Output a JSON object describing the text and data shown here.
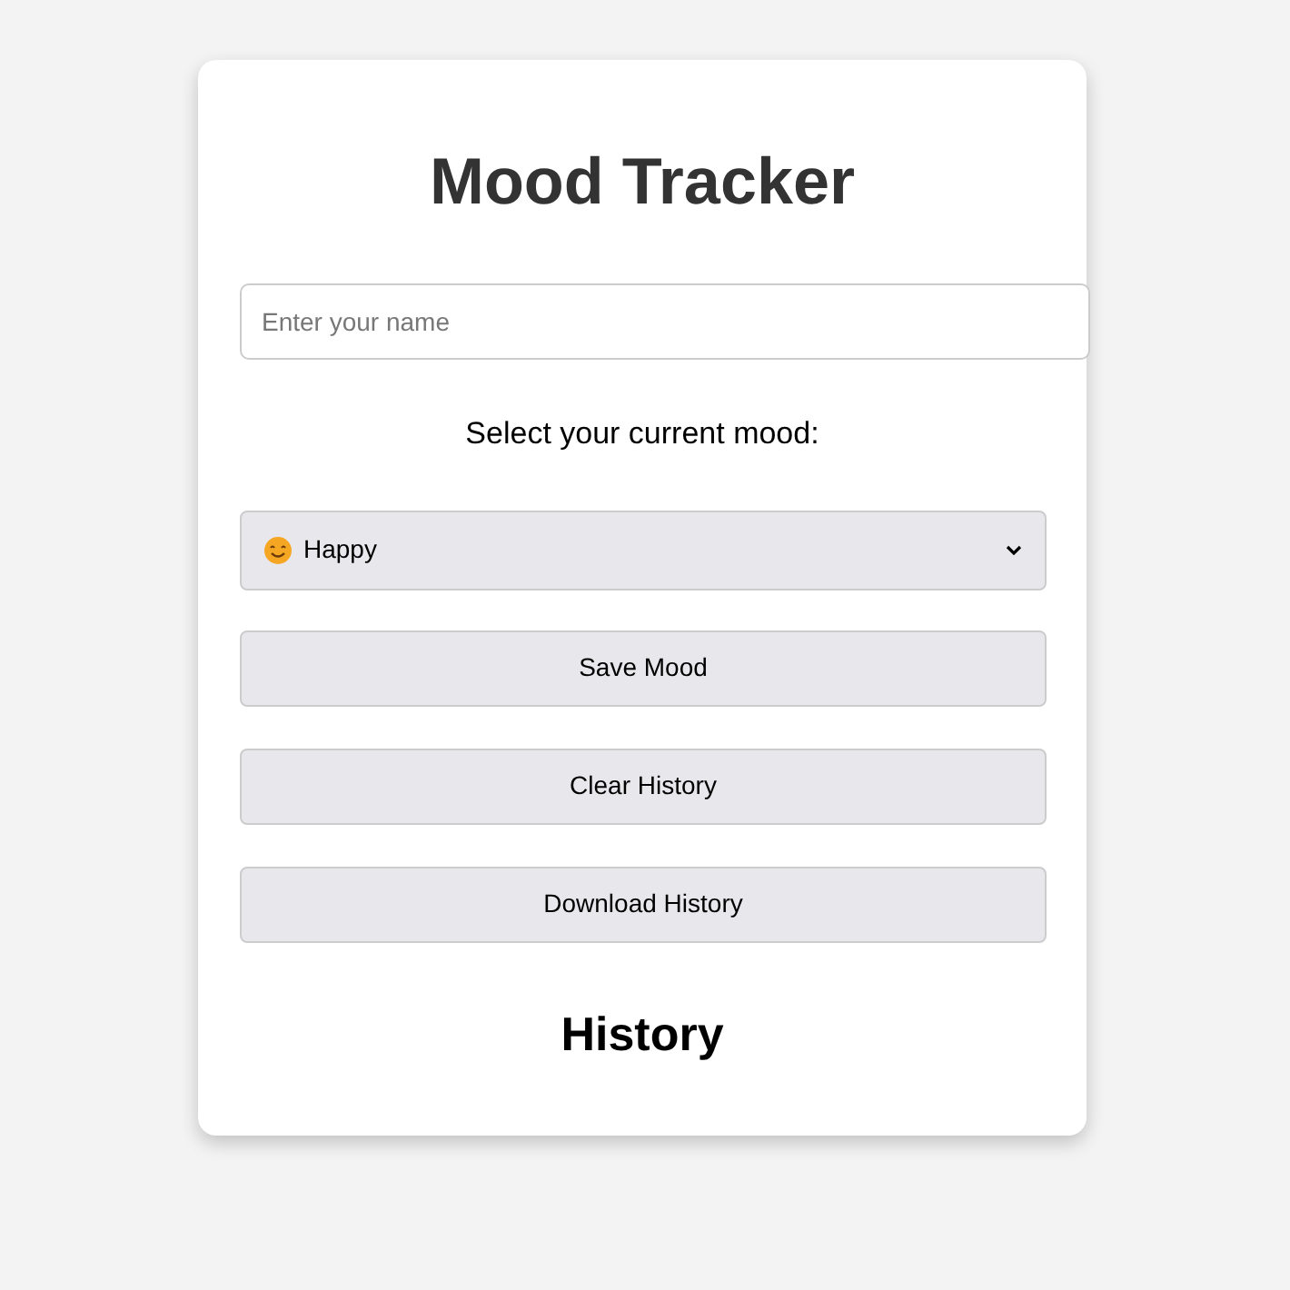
{
  "title": "Mood Tracker",
  "name_field": {
    "placeholder": "Enter your name"
  },
  "mood_prompt": "Select your current mood:",
  "mood_select": {
    "value": "Happy"
  },
  "buttons": [
    "Save Mood",
    "Clear History",
    "Download History"
  ],
  "history": {
    "title": "History"
  }
}
